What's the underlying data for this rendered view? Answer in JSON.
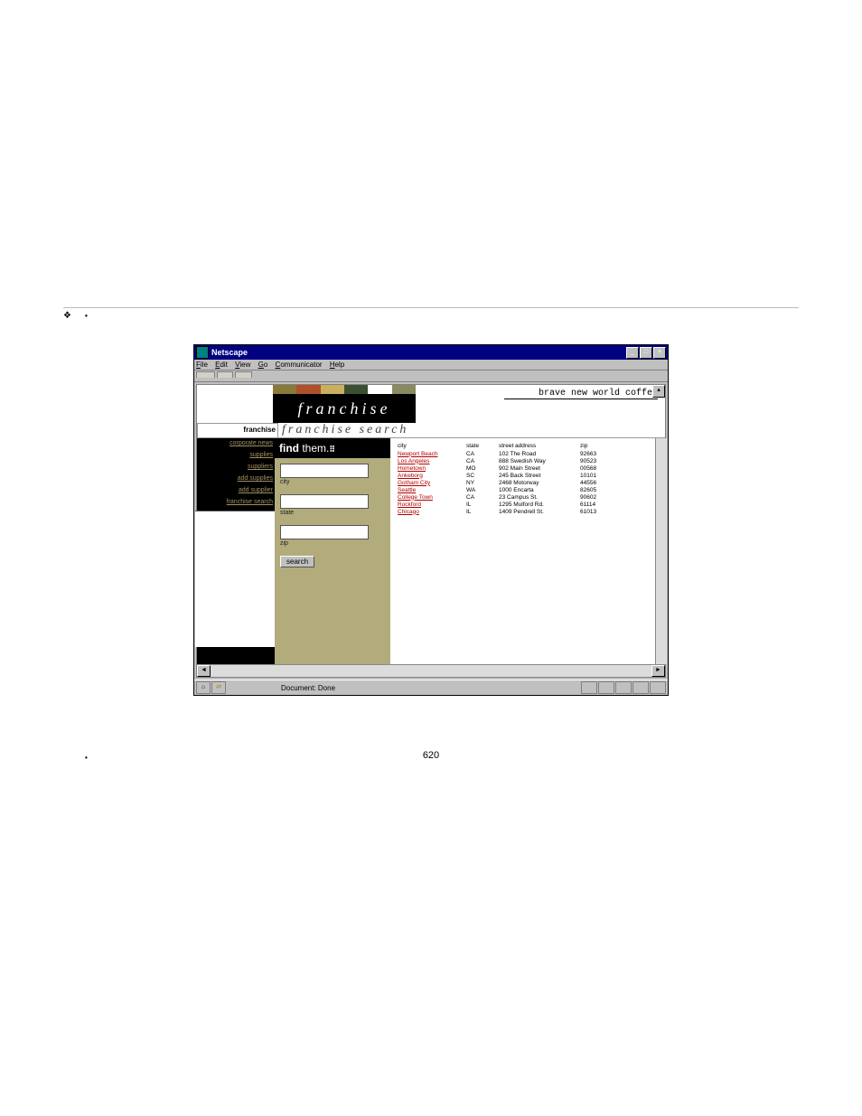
{
  "features": {
    "main": "",
    "sub": [
      "",
      "",
      ""
    ]
  },
  "window": {
    "title": "Netscape",
    "menu": [
      "File",
      "Edit",
      "View",
      "Go",
      "Communicator",
      "Help"
    ],
    "brand_line": "brave new world coffee",
    "logo_text": "franchise",
    "section_tab": "franchise",
    "section_title": "franchise search",
    "nav": [
      "corporate news",
      "supplies",
      "suppliers",
      "add supplies",
      "add supplier",
      "franchise search"
    ],
    "search": {
      "header_bold": "find",
      "header_rest": "them.",
      "city_label": "city",
      "state_label": "state",
      "zip_label": "zip",
      "button": "search"
    },
    "table": {
      "headers": [
        "city",
        "state",
        "street address",
        "zip"
      ],
      "rows": [
        {
          "city": "Newport Beach",
          "state": "CA",
          "addr": "102 The Road",
          "zip": "92663"
        },
        {
          "city": "Los Angeles",
          "state": "CA",
          "addr": "888 Swedish Way",
          "zip": "90523"
        },
        {
          "city": "Hometown",
          "state": "MO",
          "addr": "902 Main Street",
          "zip": "00568"
        },
        {
          "city": "Ankeborg",
          "state": "SC",
          "addr": "245 Back Street",
          "zip": "10101"
        },
        {
          "city": "Gotham City",
          "state": "NY",
          "addr": "2468 Motorway",
          "zip": "44556"
        },
        {
          "city": "Seattle",
          "state": "WA",
          "addr": "1000 Encarta",
          "zip": "82605"
        },
        {
          "city": "College Town",
          "state": "CA",
          "addr": "23 Campus St.",
          "zip": "90602"
        },
        {
          "city": "Rockford",
          "state": "IL",
          "addr": "1295 Mulford Rd.",
          "zip": "61114"
        },
        {
          "city": "Chicago",
          "state": "IL",
          "addr": "1409 Pendrell St.",
          "zip": "61013"
        }
      ]
    },
    "status": "Document: Done"
  },
  "after": [
    "",
    ""
  ],
  "page_number": "620"
}
